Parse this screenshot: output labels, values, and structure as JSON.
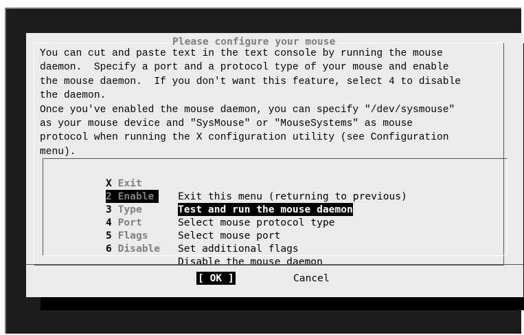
{
  "dialog": {
    "title": "Please configure your mouse",
    "message_lines": [
      "You can cut and paste text in the text console by running the mouse",
      "daemon.  Specify a port and a protocol type of your mouse and enable",
      "the mouse daemon.  If you don't want this feature, select 4 to disable",
      "the daemon.",
      "Once you've enabled the mouse daemon, you can specify \"/dev/sysmouse\"",
      "as your mouse device and \"SysMouse\" or \"MouseSystems\" as mouse",
      "protocol when running the X configuration utility (see Configuration",
      "menu)."
    ]
  },
  "menu": {
    "items": [
      {
        "hot": "X",
        "rest": " Exit",
        "desc": "Exit this menu (returning to previous)",
        "selected": false
      },
      {
        "hot": "2",
        "rest": " Enable",
        "desc": "Test and run the mouse daemon",
        "selected": true
      },
      {
        "hot": "3",
        "rest": " Type",
        "desc": "Select mouse protocol type",
        "selected": false
      },
      {
        "hot": "4",
        "rest": " Port",
        "desc": "Select mouse port",
        "selected": false
      },
      {
        "hot": "5",
        "rest": " Flags",
        "desc": "Set additional flags",
        "selected": false
      },
      {
        "hot": "6",
        "rest": " Disable",
        "desc": "Disable the mouse daemon",
        "selected": false
      }
    ]
  },
  "buttons": {
    "ok_left": "[ ",
    "ok_label": "OK",
    "ok_right": " ]",
    "cancel_label": "Cancel"
  },
  "colors": {
    "screen_bg": "#1c1c1c",
    "dialog_bg": "#ebebeb",
    "highlight_bg": "#000000",
    "dim_text": "#7f7f7f"
  }
}
